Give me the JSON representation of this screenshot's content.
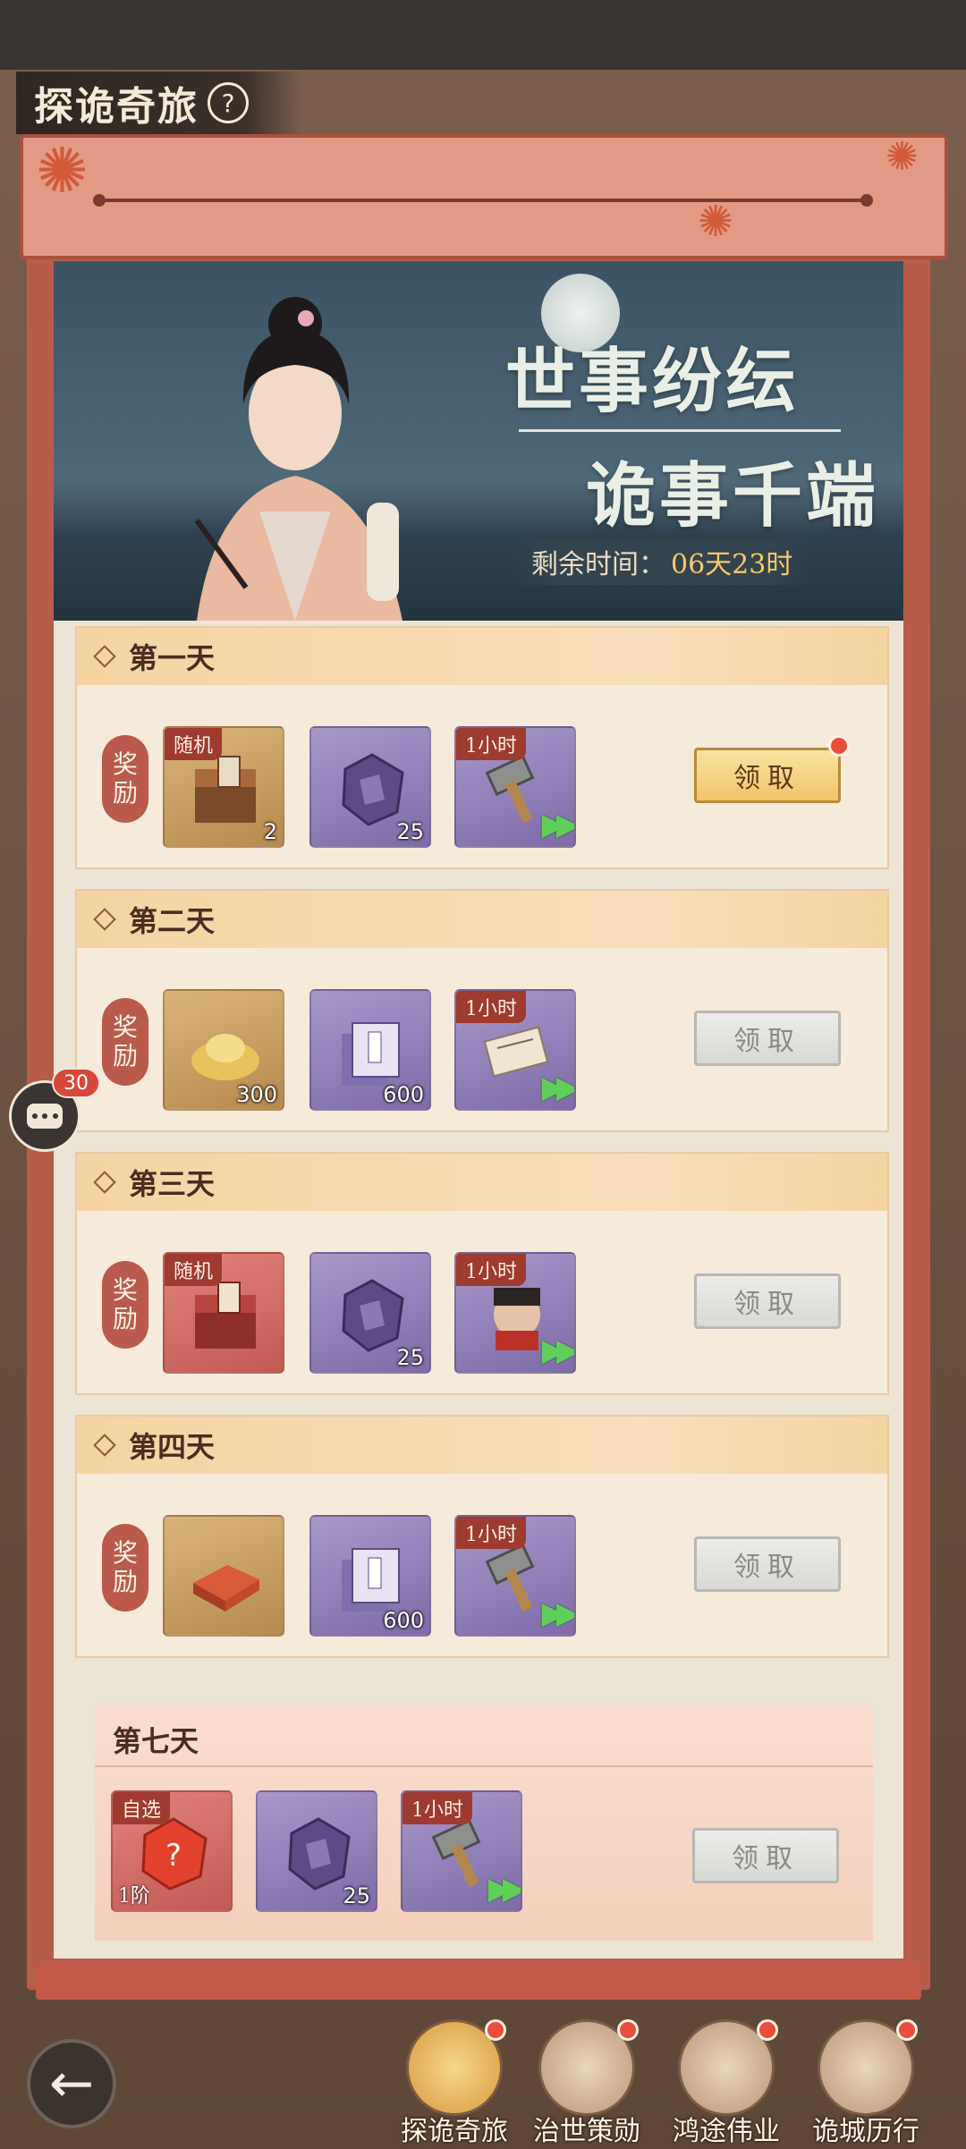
{
  "page": {
    "title": "探诡奇旅",
    "help_icon": "?"
  },
  "banner": {
    "slogan_line1": "世事纷纭",
    "slogan_line2": "诡事千端",
    "countdown_label": "剩余时间：",
    "countdown_value": "06天23时"
  },
  "reward_label_1": "奖",
  "reward_label_2": "励",
  "claim_label": "领取",
  "days": [
    {
      "title": "第一天",
      "claim_state": "active",
      "has_red_dot": true,
      "items": [
        {
          "icon": "treasure-chest-icon",
          "bg": "gold",
          "corner": "随机",
          "qty": "2"
        },
        {
          "icon": "purple-ore-icon",
          "bg": "purple",
          "corner": "",
          "qty": "25"
        },
        {
          "icon": "hammer-speedup-icon",
          "bg": "purple",
          "corner": "1小时",
          "qty": ""
        }
      ]
    },
    {
      "title": "第二天",
      "claim_state": "disabled",
      "has_red_dot": false,
      "items": [
        {
          "icon": "gold-ingot-icon",
          "bg": "gold",
          "corner": "",
          "qty": "300"
        },
        {
          "icon": "book-stack-icon",
          "bg": "purple",
          "corner": "",
          "qty": "600"
        },
        {
          "icon": "scroll-speedup-icon",
          "bg": "purple",
          "corner": "1小时",
          "qty": ""
        }
      ]
    },
    {
      "title": "第三天",
      "claim_state": "disabled",
      "has_red_dot": false,
      "items": [
        {
          "icon": "red-chest-icon",
          "bg": "red",
          "corner": "随机",
          "qty": ""
        },
        {
          "icon": "purple-ore-icon",
          "bg": "purple",
          "corner": "",
          "qty": "25"
        },
        {
          "icon": "official-speedup-icon",
          "bg": "purple",
          "corner": "1小时",
          "qty": ""
        }
      ]
    },
    {
      "title": "第四天",
      "claim_state": "disabled",
      "has_red_dot": false,
      "items": [
        {
          "icon": "red-brick-icon",
          "bg": "gold",
          "corner": "",
          "qty": ""
        },
        {
          "icon": "book-stack-icon",
          "bg": "purple",
          "corner": "",
          "qty": "600"
        },
        {
          "icon": "hammer-speedup-icon",
          "bg": "purple",
          "corner": "1小时",
          "qty": ""
        }
      ]
    }
  ],
  "day7": {
    "title": "第七天",
    "claim_state": "disabled",
    "items": [
      {
        "icon": "mystery-red-gem-icon",
        "bg": "red",
        "corner": "自选",
        "qty": "",
        "level": "1阶"
      },
      {
        "icon": "purple-ore-icon",
        "bg": "purple",
        "corner": "",
        "qty": "25"
      },
      {
        "icon": "hammer-speedup-icon",
        "bg": "purple",
        "corner": "1小时",
        "qty": ""
      }
    ]
  },
  "chat": {
    "badge": "30"
  },
  "nav": [
    {
      "label": "探诡奇旅",
      "selected": true,
      "red_dot": true
    },
    {
      "label": "治世策勋",
      "selected": false,
      "red_dot": true
    },
    {
      "label": "鸿途伟业",
      "selected": false,
      "red_dot": true
    },
    {
      "label": "诡城历行",
      "selected": false,
      "red_dot": true
    }
  ],
  "colors": {
    "accent_red": "#b85d4a",
    "claim_gold": "#f0c46a",
    "badge_red": "#e84e3b"
  }
}
